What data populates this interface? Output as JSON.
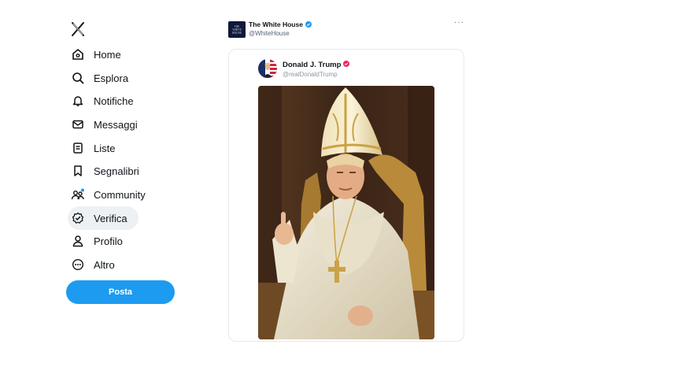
{
  "sidebar": {
    "items": [
      {
        "label": "Home",
        "icon": "home-icon"
      },
      {
        "label": "Esplora",
        "icon": "search-icon"
      },
      {
        "label": "Notifiche",
        "icon": "bell-icon"
      },
      {
        "label": "Messaggi",
        "icon": "mail-icon"
      },
      {
        "label": "Liste",
        "icon": "list-icon"
      },
      {
        "label": "Segnalibri",
        "icon": "bookmark-icon"
      },
      {
        "label": "Community",
        "icon": "community-icon"
      },
      {
        "label": "Verifica",
        "icon": "verified-icon"
      },
      {
        "label": "Profilo",
        "icon": "profile-icon"
      },
      {
        "label": "Altro",
        "icon": "more-circle-icon"
      }
    ],
    "post_label": "Posta"
  },
  "tweet": {
    "author_name": "The White House",
    "author_handle": "@WhiteHouse",
    "avatar_text": [
      "THE",
      "WHITE",
      "HOUSE"
    ],
    "more_label": "···",
    "quoted": {
      "author_name": "Donald J. Trump",
      "author_handle": "@realDonaldTrump"
    }
  },
  "colors": {
    "accent": "#1d9bf0",
    "verified_blue": "#1d9bf0",
    "verified_pink": "#f4245e",
    "text_primary": "#0f1419",
    "text_secondary": "#536471"
  }
}
